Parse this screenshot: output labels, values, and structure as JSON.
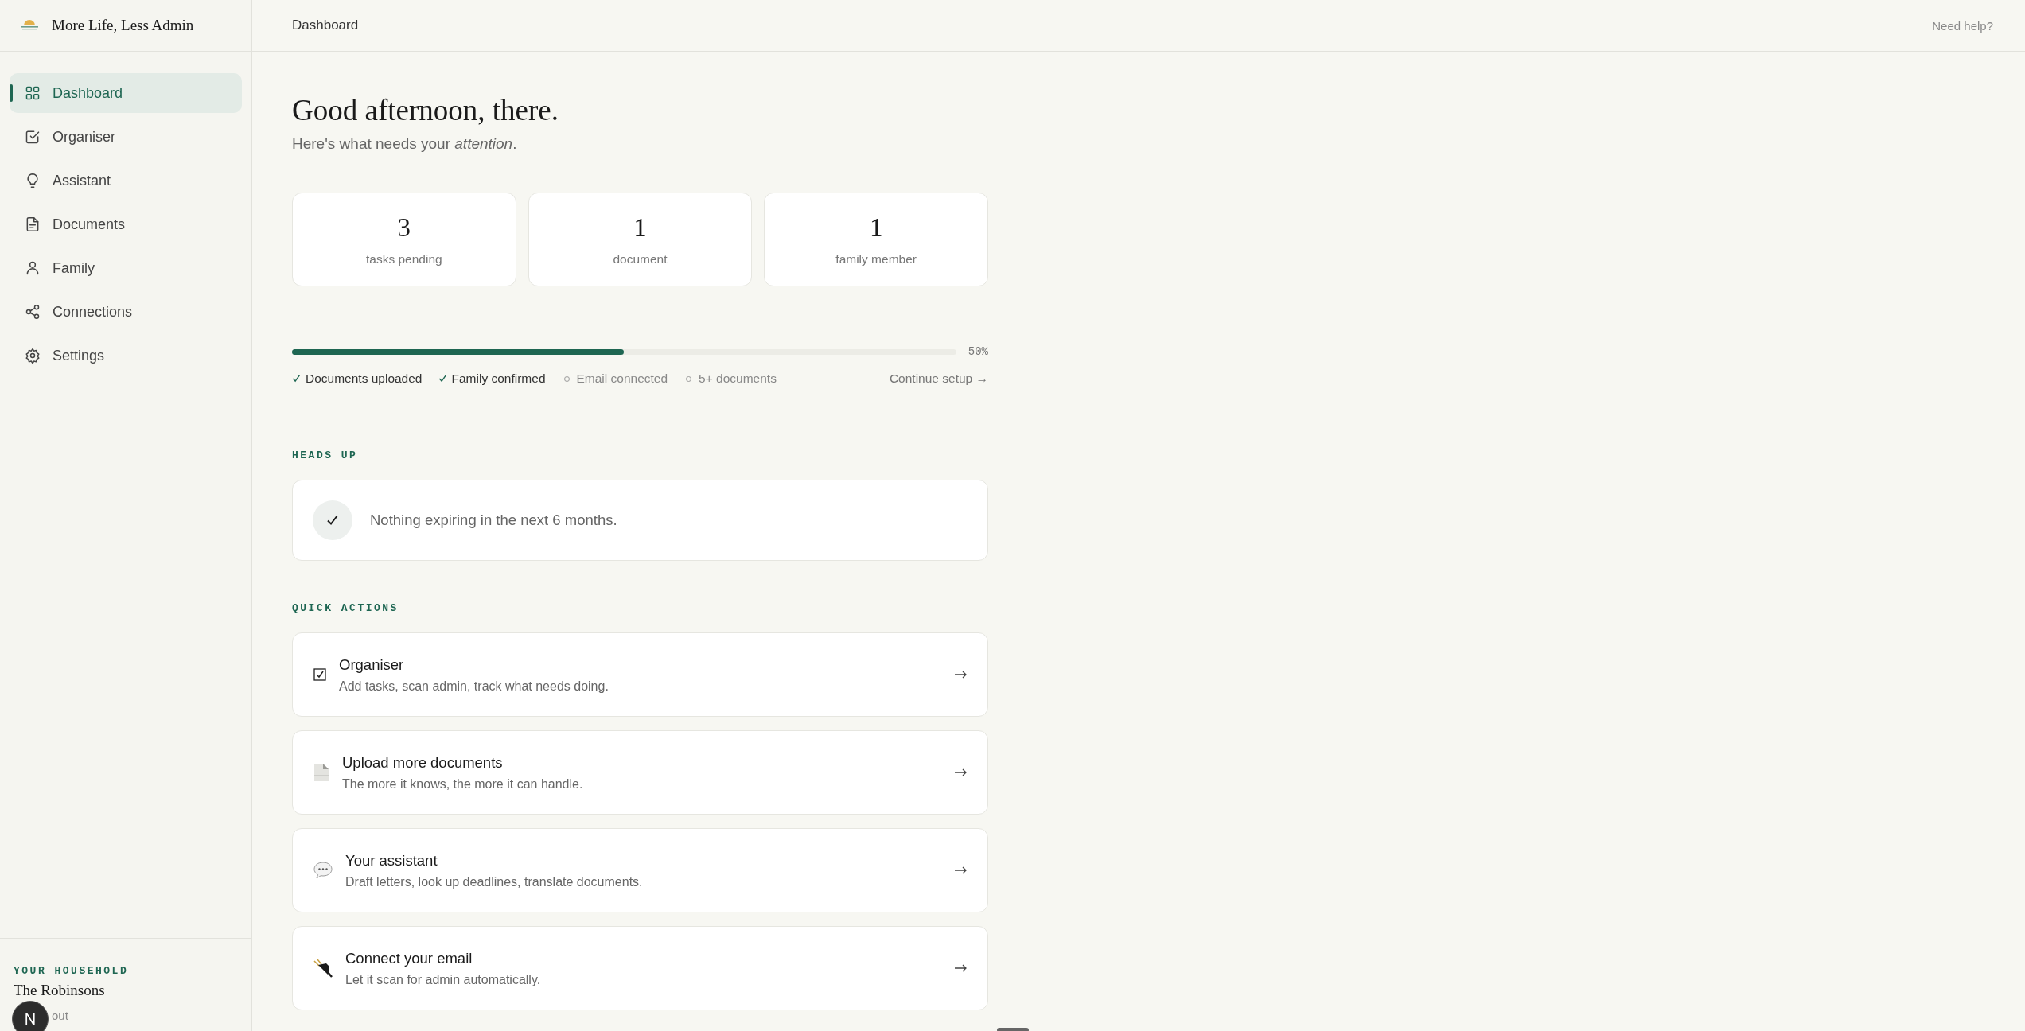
{
  "brand": {
    "title": "More Life, Less Admin"
  },
  "sidebar": {
    "items": [
      {
        "label": "Dashboard",
        "kind": "grid",
        "selected": true
      },
      {
        "label": "Organiser",
        "kind": "check",
        "selected": false
      },
      {
        "label": "Assistant",
        "kind": "bulb",
        "selected": false
      },
      {
        "label": "Documents",
        "kind": "doc",
        "selected": false
      },
      {
        "label": "Family",
        "kind": "person",
        "selected": false
      },
      {
        "label": "Connections",
        "kind": "share",
        "selected": false
      },
      {
        "label": "Settings",
        "kind": "gear",
        "selected": false
      }
    ],
    "household": {
      "label": "YOUR HOUSEHOLD",
      "name": "The Robinsons",
      "sign_out": "out"
    },
    "avatar": "N"
  },
  "topbar": {
    "title": "Dashboard",
    "help": "Need help?"
  },
  "greeting": {
    "title": "Good afternoon, there.",
    "subtitle": "Here's what needs your *attention*."
  },
  "stats": [
    {
      "value": "3",
      "label": "tasks pending"
    },
    {
      "value": "1",
      "label": "document"
    },
    {
      "value": "1",
      "label": "family member"
    }
  ],
  "setup": {
    "level": 0.5,
    "reading": "50%",
    "continue": "Continue setup →",
    "steps": [
      {
        "label": "Documents uploaded",
        "done": true
      },
      {
        "label": "Family confirmed",
        "done": true
      },
      {
        "label": "Email connected",
        "done": false
      },
      {
        "label": "5+ documents",
        "done": false
      }
    ]
  },
  "heads_up": {
    "title": "HEADS UP",
    "message": "Nothing expiring in the next 6 months."
  },
  "quick_actions": {
    "title": "QUICK ACTIONS",
    "items": [
      {
        "kind": "checkbox",
        "title": "Organiser",
        "description": "Add tasks, scan admin, track what needs doing."
      },
      {
        "kind": "document",
        "title": "Upload more documents",
        "description": "The more it knows, the more it can handle."
      },
      {
        "kind": "speech",
        "title": "Your assistant",
        "description": "Draft letters, look up deadlines, translate documents."
      },
      {
        "kind": "plug",
        "title": "Connect your email",
        "description": "Let it scan for admin automatically."
      }
    ]
  }
}
